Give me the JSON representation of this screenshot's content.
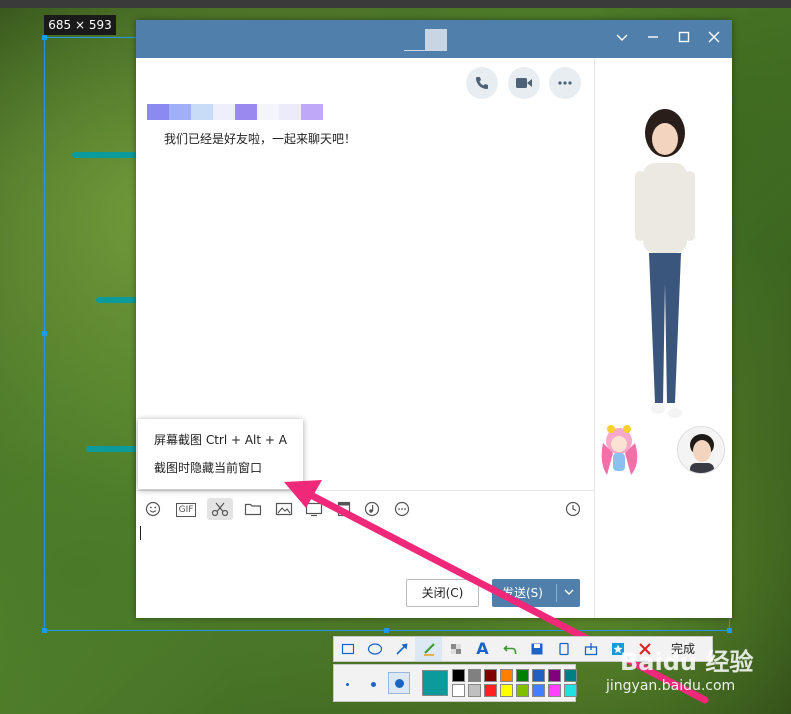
{
  "capture": {
    "size_label": "685 × 593",
    "selection_color": "#1e9be6"
  },
  "window": {
    "title_color": "#4f7faa",
    "minimize_icon": "chevron-down-icon",
    "restore_icon": "minus-icon",
    "maximize_icon": "square-icon",
    "close_icon": "close-icon"
  },
  "chat": {
    "system_message": "我们已经是好友啦，一起来聊天吧！",
    "header_actions": [
      "phone-icon",
      "video-icon",
      "more-icon"
    ]
  },
  "context_menu": {
    "items": [
      {
        "label": "屏幕截图 Ctrl + Alt + A"
      },
      {
        "label": "截图时隐藏当前窗口"
      }
    ]
  },
  "input_toolbar": {
    "tools": [
      "emoji-icon",
      "gif-icon",
      "scissors-icon",
      "folder-icon",
      "image-icon",
      "screen-share-icon",
      "doc-icon",
      "music-icon",
      "more-icon",
      "history-icon"
    ],
    "gif_label": "GIF"
  },
  "buttons": {
    "close_label": "关闭(C)",
    "send_label": "发送(S)",
    "send_arrow": "chevron-down-icon"
  },
  "screenshot_toolbar": {
    "tools": [
      "rectangle-icon",
      "ellipse-icon",
      "arrow-icon",
      "brush-icon",
      "mosaic-icon",
      "text-icon",
      "undo-icon",
      "save-icon",
      "pin-icon",
      "share-icon",
      "star-icon",
      "cancel-icon"
    ],
    "done_label": "完成",
    "selected_color": "#0d9a9a",
    "palette": [
      "#000000",
      "#808080",
      "#800000",
      "#ff8000",
      "#008000",
      "#2060c0",
      "#800080",
      "#008080",
      "#ffffff",
      "#c0c0c0",
      "#ff2020",
      "#ffff00",
      "#80c000",
      "#4080ff",
      "#ff40ff",
      "#20e0e0"
    ]
  },
  "watermark": {
    "brand": "Baidu 经验",
    "url": "jingyan.baidu.com"
  }
}
